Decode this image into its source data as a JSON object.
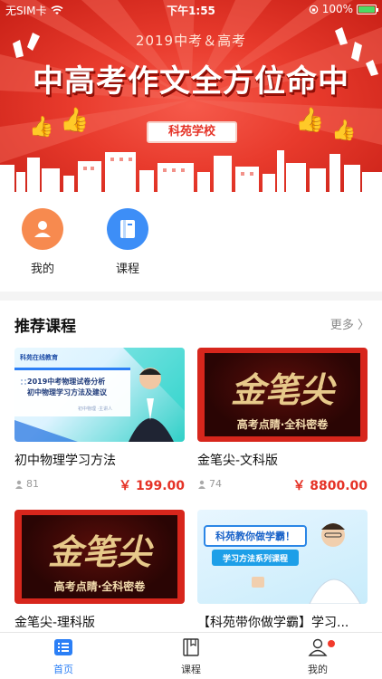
{
  "status_bar": {
    "carrier": "无SIM卡",
    "time": "下午1:55",
    "battery": "100%",
    "battery_level": 1.0
  },
  "banner": {
    "subtitle": "2019中考＆高考",
    "title": "中高考作文全方位命中",
    "school": "科苑学校",
    "colors": {
      "background": "#e83a2c",
      "title_text": "#ffffff"
    }
  },
  "quick_entries": [
    {
      "label": "我的",
      "icon": "user-icon",
      "color": "#f78a4f"
    },
    {
      "label": "课程",
      "icon": "book-icon",
      "color": "#3d8ef7"
    }
  ],
  "recommended": {
    "title": "推荐课程",
    "more": "更多",
    "courses": [
      {
        "name": "初中物理学习方法",
        "students": "81",
        "price": "￥ 199.00",
        "image_text": {
          "org": "科苑在线教育",
          "line1": "2019中考物理试卷分析",
          "line2": "初中物理学习方法及建议",
          "caption": "初中物理 ·主讲人"
        }
      },
      {
        "name": "金笔尖-文科版",
        "students": "74",
        "price": "￥ 8800.00",
        "image_text": {
          "calligraphy": "金笔尖",
          "tagline": "高考点睛·全科密卷"
        }
      },
      {
        "name": "金笔尖-理科版",
        "students": "",
        "price": "",
        "image_text": {
          "calligraphy": "金笔尖",
          "tagline": "高考点睛·全科密卷"
        }
      },
      {
        "name": "【科苑带你做学霸】学习...",
        "students": "",
        "price": "",
        "image_text": {
          "headline": "科苑教你做学霸！",
          "sub": "学习方法系列课程"
        }
      }
    ]
  },
  "tabbar": {
    "items": [
      {
        "label": "首页",
        "icon": "home-list-icon",
        "active": true
      },
      {
        "label": "课程",
        "icon": "book-icon",
        "active": false
      },
      {
        "label": "我的",
        "icon": "user-icon",
        "active": false,
        "badge_dot": true
      }
    ],
    "accent": "#2b7ff6"
  }
}
